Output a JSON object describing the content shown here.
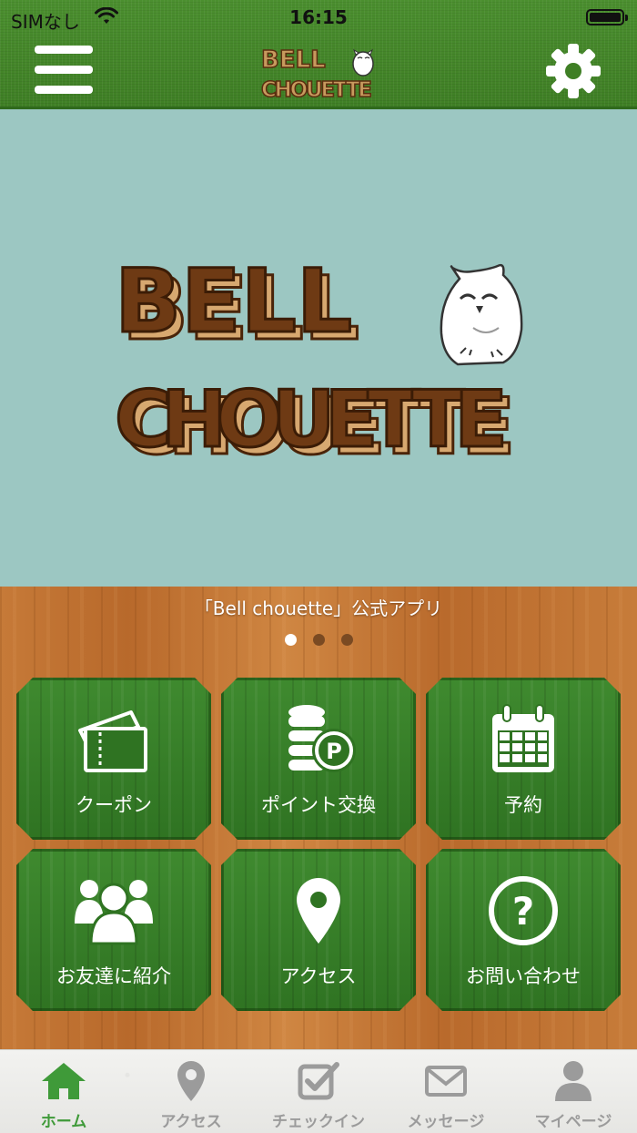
{
  "status_bar": {
    "carrier": "SIMなし",
    "time": "16:15"
  },
  "nav": {
    "logo_line1": "BELL",
    "logo_line2": "CHOUETTE"
  },
  "hero": {
    "logo_line1": "BELL",
    "logo_line2": "CHOUETTE"
  },
  "main": {
    "tagline": "「Bell chouette」公式アプリ",
    "slide_count": 3,
    "active_slide": 1,
    "tiles": [
      {
        "label": "クーポン",
        "icon": "ticket-icon"
      },
      {
        "label": "ポイント交換",
        "icon": "coins-point-icon"
      },
      {
        "label": "予約",
        "icon": "calendar-icon"
      },
      {
        "label": "お友達に紹介",
        "icon": "users-icon"
      },
      {
        "label": "アクセス",
        "icon": "map-pin-icon"
      },
      {
        "label": "お問い合わせ",
        "icon": "question-icon"
      }
    ]
  },
  "tabbar": {
    "items": [
      {
        "label": "ホーム",
        "icon": "home-icon",
        "active": true
      },
      {
        "label": "アクセス",
        "icon": "map-pin-icon",
        "active": false
      },
      {
        "label": "チェックイン",
        "icon": "checkin-icon",
        "active": false
      },
      {
        "label": "メッセージ",
        "icon": "mail-icon",
        "active": false
      },
      {
        "label": "マイページ",
        "icon": "user-icon",
        "active": false
      }
    ]
  },
  "colors": {
    "nav_green": "#3f7f25",
    "tile_green": "#2f7322",
    "hero_bg": "#9cc7c2",
    "wood": "#c67a38",
    "tab_active": "#3f9a39",
    "tab_inactive": "#9b9b9b"
  }
}
